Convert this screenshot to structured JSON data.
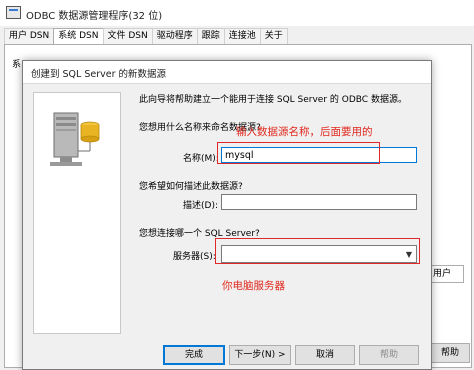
{
  "window": {
    "title": "ODBC 数据源管理程序(32 位)",
    "tabs": [
      "用户 DSN",
      "系统 DSN",
      "文件 DSN",
      "驱动程序",
      "跟踪",
      "连接池",
      "关于"
    ],
    "active_tab": "系统 DSN",
    "bg_label_s": "系",
    "bg_label_r": "用户",
    "bg_help": "帮助"
  },
  "dialog": {
    "title": "创建到 SQL Server 的新数据源",
    "intro": "此向导将帮助建立一个能用于连接 SQL Server 的 ODBC 数据源。",
    "q_name": "您想用什么名称来命名数据源?",
    "name_label": "名称(M):",
    "name_value": "mysql",
    "q_desc": "您希望如何描述此数据源?",
    "desc_label": "描述(D):",
    "desc_value": "",
    "q_server": "您想连接哪一个 SQL Server?",
    "server_label": "服务器(S):",
    "server_value": "",
    "buttons": {
      "finish": "完成",
      "next": "下一步(N) >",
      "cancel": "取消",
      "help": "帮助"
    }
  },
  "annotations": {
    "name_note": "输入数据源名称，后面要用的",
    "server_note": "你电脑服务器"
  },
  "icons": [
    "app-icon",
    "server-database-icon",
    "chevron-down-icon"
  ],
  "colors": {
    "annotation": "#e0281d",
    "focus": "#0078d7"
  }
}
